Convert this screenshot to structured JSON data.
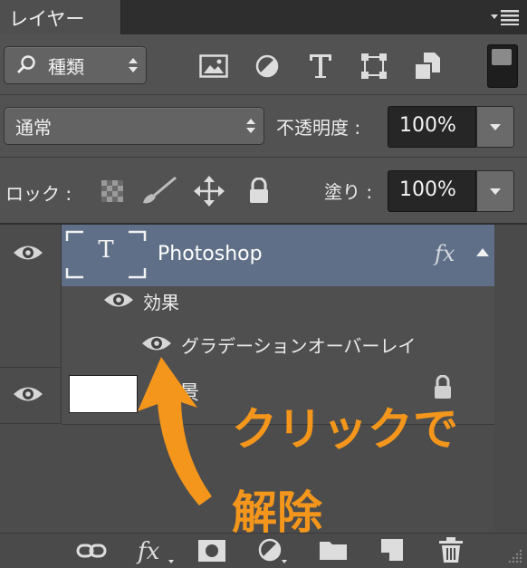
{
  "panel": {
    "tab_label": "レイヤー"
  },
  "filter": {
    "kind_label": "種類"
  },
  "blend": {
    "mode_label": "通常",
    "opacity_label": "不透明度 :",
    "opacity_value": "100%"
  },
  "lock": {
    "lock_label": "ロック :",
    "fill_label": "塗り :",
    "fill_value": "100%"
  },
  "layers": [
    {
      "name": "Photoshop",
      "type": "text",
      "fx": "fx",
      "selected": true
    },
    {
      "name": "景",
      "type": "background"
    }
  ],
  "effects": {
    "group_label": "効果",
    "items": [
      "グラデーションオーバーレイ"
    ]
  },
  "annotation": {
    "line1": "クリックで",
    "line2": "解除",
    "color": "#f3961b"
  },
  "colors": {
    "selection": "#5e6f87",
    "panel_bg": "#525252"
  }
}
